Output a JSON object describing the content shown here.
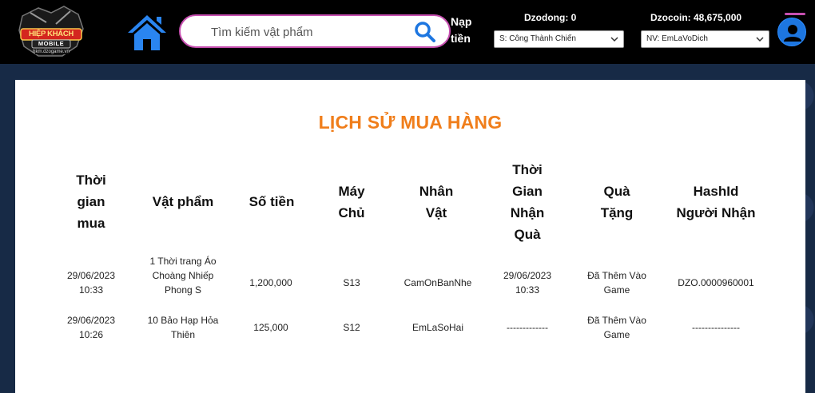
{
  "header": {
    "search_placeholder": "Tìm kiếm vật phẩm",
    "topup_label": "Nạp tiền",
    "dzodong_label": "Dzodong: 0",
    "dzocoin_label": "Dzocoin: 48,675,000",
    "server_select": "S: Công Thành Chiến",
    "character_select": "NV: EmLaVoDich",
    "logo_text": [
      "HIỆP KHÁCH",
      "MOBILE",
      "hkm.dzogame.vn"
    ]
  },
  "colors": {
    "accent": "#f07e1b",
    "topbar": "#000000",
    "search_border": "#c64fb0",
    "avatar": "#1d76e0",
    "home_icon": "#2a85f0"
  },
  "page": {
    "title": "LỊCH SỬ MUA HÀNG"
  },
  "table": {
    "columns": [
      "Thời gian mua",
      "Vật phẩm",
      "Số tiền",
      "Máy Chủ",
      "Nhân Vật",
      "Thời Gian Nhận Quà",
      "Quà Tặng",
      "HashId Người Nhận"
    ],
    "rows": [
      [
        "29/06/2023 10:33",
        "1 Thời trang Áo Choàng Nhiếp Phong S",
        "1,200,000",
        "S13",
        "CamOnBanNhe",
        "29/06/2023 10:33",
        "Đã Thêm Vào Game",
        "DZO.0000960001"
      ],
      [
        "29/06/2023 10:26",
        "10 Bảo Hạp Hỏa Thiên",
        "125,000",
        "S12",
        "EmLaSoHai",
        "-------------",
        "Đã Thêm Vào Game",
        "---------------"
      ]
    ]
  }
}
